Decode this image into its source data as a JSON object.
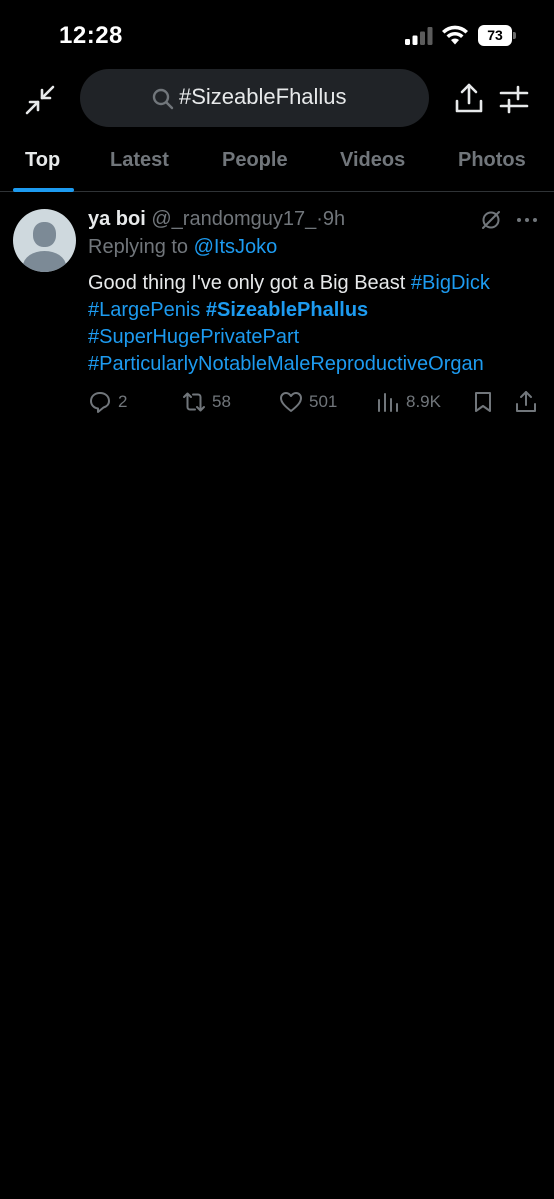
{
  "status_bar": {
    "time": "12:28",
    "battery": "73",
    "icons": [
      "cellular-signal-icon",
      "wifi-icon",
      "battery-icon"
    ]
  },
  "header": {
    "search_query": "#SizeableFhallus",
    "icons": [
      "collapse-icon",
      "search-icon",
      "share-icon",
      "filter-icon"
    ]
  },
  "tabs": [
    {
      "label": "Top",
      "active": true
    },
    {
      "label": "Latest",
      "active": false
    },
    {
      "label": "People",
      "active": false
    },
    {
      "label": "Videos",
      "active": false
    },
    {
      "label": "Photos",
      "active": false
    }
  ],
  "tweet": {
    "display_name": "ya boi",
    "handle": "@_randomguy17_",
    "separator": "·",
    "age": "9h",
    "replying_prefix": "Replying to",
    "replying_to": "@ItsJoko",
    "text": {
      "lead": "Good thing I've only got a Big Beast",
      "hashtags": [
        "#BigDick",
        "#LargePenis",
        "#SizeablePhallus",
        "#SuperHugePrivatePart",
        "#ParticularlyNotableMaleReproductiveOrgan"
      ]
    },
    "stats": {
      "replies": "2",
      "reposts": "58",
      "likes": "501",
      "views": "8.9K"
    }
  },
  "colors": {
    "background": "#000000",
    "accent": "#1d9bf0",
    "secondary_text": "#71767b",
    "primary_text": "#e7e9ea",
    "search_pill": "#202327"
  }
}
